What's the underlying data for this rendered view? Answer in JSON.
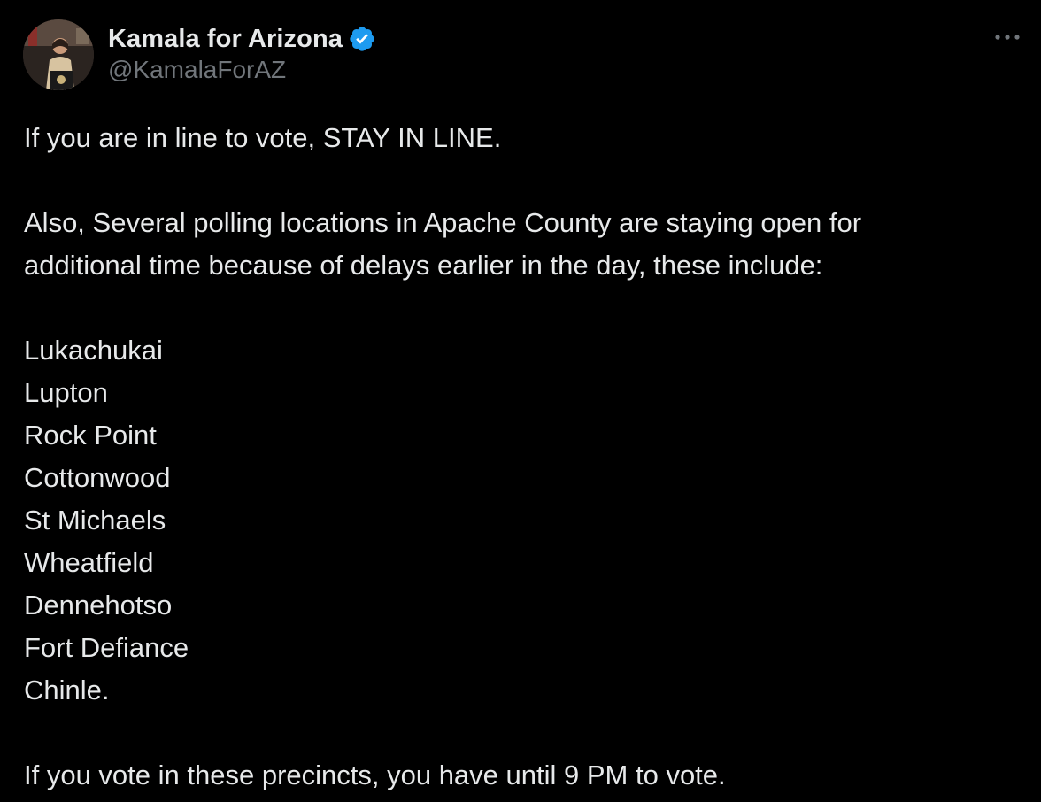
{
  "author": {
    "display_name": "Kamala for Arizona",
    "handle": "@KamalaForAZ",
    "avatar_icon": "profile-photo",
    "verified_icon": "verified-badge-icon",
    "verified_color": "#1d9bf0"
  },
  "menu": {
    "more_icon": "more-horizontal-icon"
  },
  "tweet": {
    "line1": "If you are in line to vote, STAY IN LINE.",
    "line2a": "Also, Several polling locations in Apache County are staying open for",
    "line2b": "additional time because of delays earlier in the day, these include:",
    "locations": [
      "Lukachukai",
      "Lupton",
      "Rock Point",
      "Cottonwood",
      "St Michaels",
      "Wheatfield",
      "Dennehotso",
      "Fort Defiance",
      "Chinle."
    ],
    "closing": "If you vote in these precincts, you have until 9 PM to vote."
  },
  "colors": {
    "background": "#000000",
    "text_primary": "#e7e9ea",
    "text_secondary": "#71767b"
  }
}
